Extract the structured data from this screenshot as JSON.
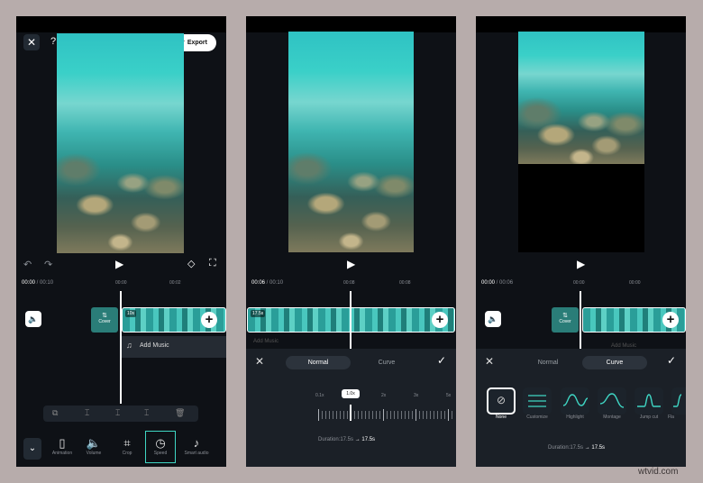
{
  "screen1": {
    "export_label": "Export",
    "help_glyph": "?",
    "time_current": "00:00",
    "time_total": "00:10",
    "ruler": [
      "00:00",
      "00:02"
    ],
    "clip_label": "Cover",
    "clip_badge": "10s",
    "add_music_label": "Add Music",
    "toolbar": [
      "Animation",
      "Volume",
      "Crop",
      "Speed",
      "Smart audio"
    ]
  },
  "screen2": {
    "time_current": "00:06",
    "time_total": "00:10",
    "ruler": [
      "00:08",
      "00:08"
    ],
    "clip_badge": "17.5s",
    "ghost_label": "Add Music",
    "tabs": {
      "normal": "Normal",
      "curve": "Curve"
    },
    "speed_marks": [
      "0.1x",
      "1.0x",
      "2x",
      "3x",
      "5x"
    ],
    "duration_label": "Duration:17.5s",
    "arrow": "→",
    "duration_new": "17.5s"
  },
  "screen3": {
    "time_current": "00:00",
    "time_total": "00:06",
    "ruler": [
      "00:00",
      "00:00"
    ],
    "clip_label": "Cover",
    "ghost_label": "Add Music",
    "tabs": {
      "normal": "Normal",
      "curve": "Curve"
    },
    "presets": [
      "None",
      "Customize",
      "Highlight",
      "Montage",
      "Jump cut",
      "Fla"
    ],
    "duration_label": "Duration:17.5s",
    "arrow": "→",
    "duration_new": "17.5s"
  },
  "watermark": "wtvid.com",
  "colors": {
    "accent": "#3fd6c4",
    "panel": "#0e1116",
    "frame": "#b7acab"
  }
}
